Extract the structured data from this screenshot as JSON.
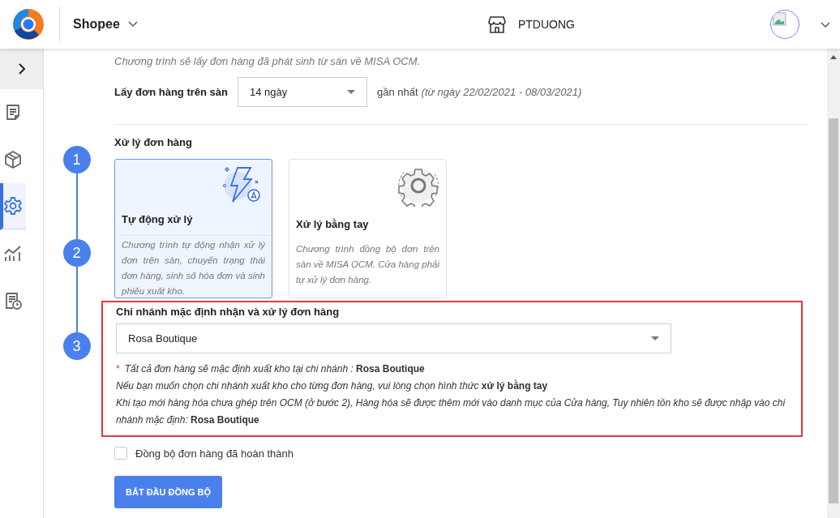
{
  "header": {
    "channel": "Shopee",
    "shop": "PTDUONG"
  },
  "sidebar": {
    "items": [
      {
        "kind": "orders",
        "selected": false
      },
      {
        "kind": "products",
        "selected": false
      },
      {
        "kind": "settings",
        "selected": true
      },
      {
        "kind": "reports",
        "selected": false
      },
      {
        "kind": "history",
        "selected": false
      }
    ]
  },
  "intro": "Chương trình sẽ lấy đơn hàng đã phát sinh từ sàn về MISA OCM.",
  "range": {
    "label": "Lấy đơn hàng trên sàn",
    "value": "14 ngày",
    "suffix": "gần nhất",
    "period": "(từ ngày 22/02/2021 - 08/03/2021)"
  },
  "steps": [
    "1",
    "2",
    "3"
  ],
  "processing": {
    "title": "Xử lý đơn hàng",
    "modes": [
      {
        "kind": "auto",
        "title": "Tự động xử lý",
        "description": "Chương trình tự động nhận xử lý đơn trên sàn, chuyển trạng thái đơn hàng, sinh số hóa đơn và sinh phiếu xuất kho.",
        "selected": true
      },
      {
        "kind": "manual",
        "title": "Xử lý bằng tay",
        "description": "Chương trình đồng bộ đơn trên sàn về MISA OCM. Cửa hàng phải tự xử lý đơn hàng.",
        "selected": false
      }
    ]
  },
  "branch": {
    "highlighted": true,
    "label": "Chi nhánh mặc định nhận và xử lý đơn hàng",
    "value": "Rosa Boutique",
    "notes": [
      {
        "marker": "*",
        "text": "Tất cả đơn hàng sẽ mặc định xuất kho tại chi nhánh : **Rosa Boutique**"
      },
      {
        "text": "Nếu bạn muốn chọn chi nhánh xuất kho cho từng đơn hàng, vui lòng chọn hình thức **xử lý bằng tay**"
      },
      {
        "text": "Khi tạo mới hàng hóa chưa ghép trên OCM (ở bước 2), Hàng hóa sẽ được thêm mới vào danh mục của Cửa hàng, Tuy nhiên tồn kho sẽ được nhập vào chi nhánh mặc định: **Rosa Boutique**"
      }
    ]
  },
  "sync_completed": {
    "label": "Đồng bộ đơn hàng đã hoàn thành",
    "checked": false
  },
  "start_button": "BẮT ĐẦU ĐỒNG BỘ"
}
